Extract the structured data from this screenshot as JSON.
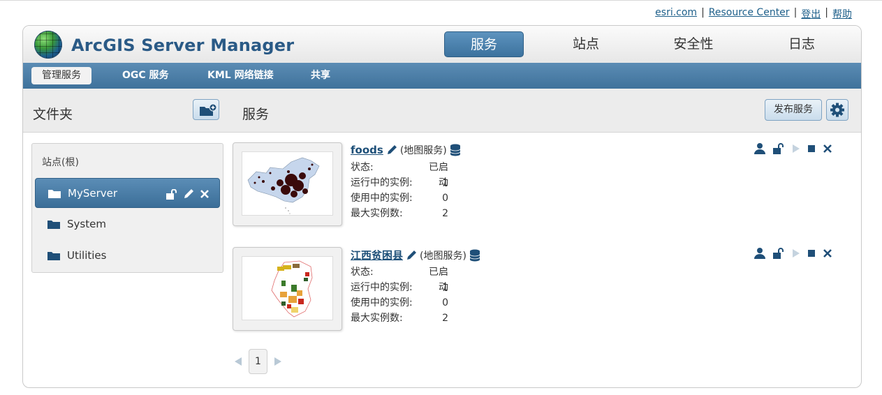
{
  "toplinks": {
    "esri": "esri.com",
    "resource": "Resource Center",
    "logout": "登出",
    "help": "帮助",
    "sep": "|"
  },
  "app": {
    "title": "ArcGIS Server Manager"
  },
  "main_tabs": [
    "服务",
    "站点",
    "安全性",
    "日志"
  ],
  "sub_tabs": [
    "管理服务",
    "OGC 服务",
    "KML 网络链接",
    "共享"
  ],
  "toolbar": {
    "folders_title": "文件夹",
    "services_title": "服务",
    "publish_label": "发布服务"
  },
  "folders": {
    "root": "站点(根)",
    "items": [
      {
        "label": "MyServer"
      },
      {
        "label": "System"
      },
      {
        "label": "Utilities"
      }
    ]
  },
  "services": [
    {
      "name": "foods",
      "type": "(地图服务)",
      "status_label": "状态:",
      "status": "已启动",
      "running_label": "运行中的实例:",
      "running": "1",
      "inuse_label": "使用中的实例:",
      "inuse": "0",
      "max_label": "最大实例数:",
      "max": "2"
    },
    {
      "name": "江西贫困县",
      "type": "(地图服务)",
      "status_label": "状态:",
      "status": "已启动",
      "running_label": "运行中的实例:",
      "running": "1",
      "inuse_label": "使用中的实例:",
      "inuse": "0",
      "max_label": "最大实例数:",
      "max": "2"
    }
  ],
  "pager": {
    "current": "1"
  },
  "colors": {
    "accent": "#3f729b",
    "link": "#1d5f8a",
    "icon": "#1f4f78"
  }
}
